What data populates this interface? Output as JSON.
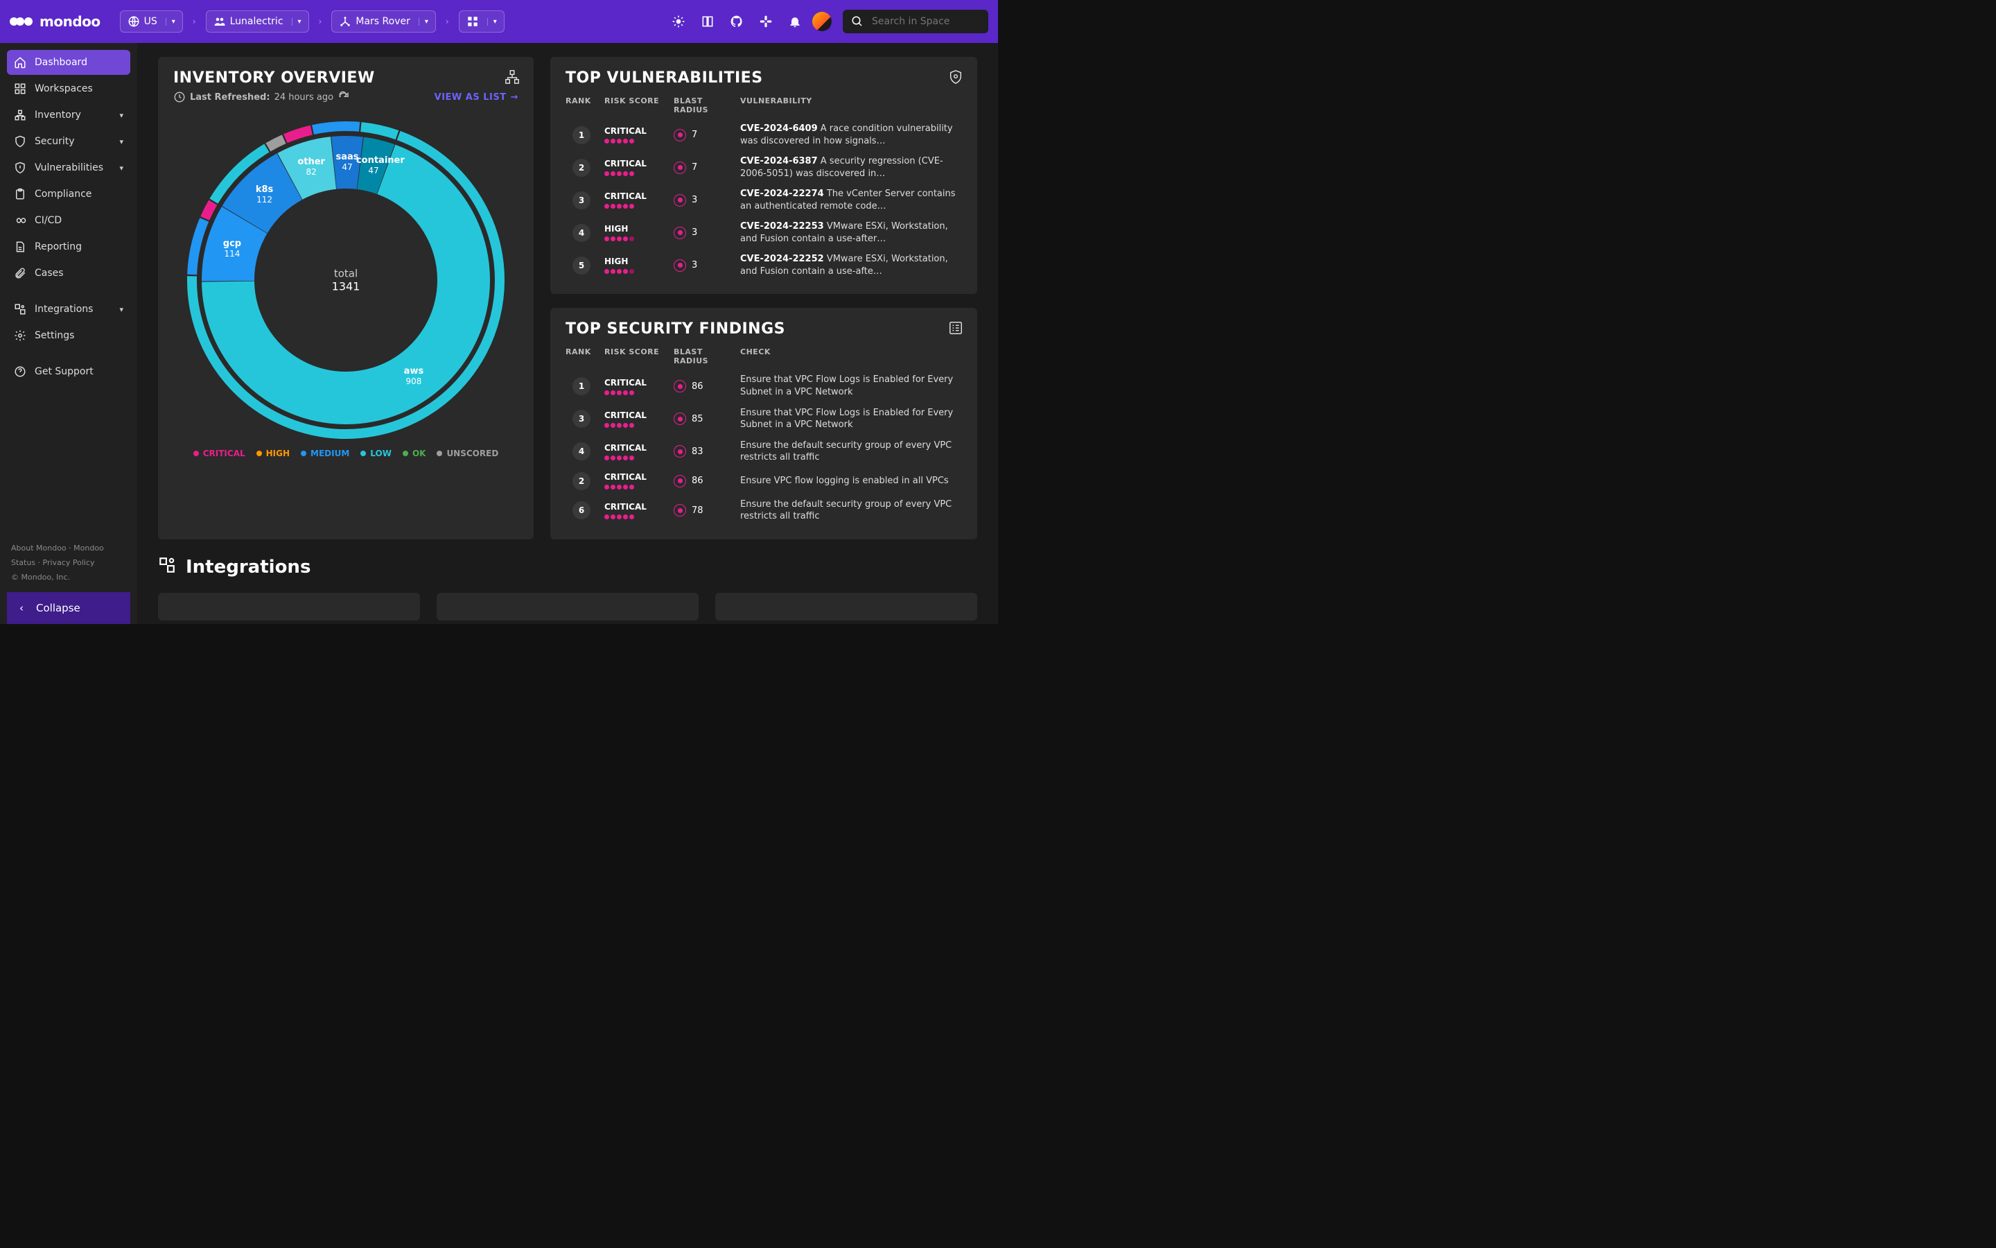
{
  "brand": "mondoo",
  "breadcrumbs": {
    "region": "US",
    "org": "Lunalectric",
    "space": "Mars Rover"
  },
  "search": {
    "placeholder": "Search in Space"
  },
  "sidebar": {
    "items": [
      {
        "label": "Dashboard",
        "active": true
      },
      {
        "label": "Workspaces"
      },
      {
        "label": "Inventory",
        "expand": true
      },
      {
        "label": "Security",
        "expand": true
      },
      {
        "label": "Vulnerabilities",
        "expand": true
      },
      {
        "label": "Compliance"
      },
      {
        "label": "CI/CD"
      },
      {
        "label": "Reporting"
      },
      {
        "label": "Cases"
      }
    ],
    "secondary": [
      {
        "label": "Integrations",
        "expand": true
      },
      {
        "label": "Settings"
      }
    ],
    "support": "Get Support",
    "footer_links": "About Mondoo · Mondoo Status · Privacy Policy",
    "copyright": "© Mondoo, Inc.",
    "collapse": "Collapse"
  },
  "inventory": {
    "title": "INVENTORY OVERVIEW",
    "last_refreshed_label": "Last Refreshed:",
    "last_refreshed_value": "24 hours ago",
    "view_as_list": "VIEW AS LIST",
    "center_label": "total",
    "center_value": "1341",
    "legend": [
      {
        "label": "CRITICAL",
        "color": "#e91e8c"
      },
      {
        "label": "HIGH",
        "color": "#ff9800"
      },
      {
        "label": "MEDIUM",
        "color": "#2196f3"
      },
      {
        "label": "LOW",
        "color": "#26c6da"
      },
      {
        "label": "OK",
        "color": "#4caf50"
      },
      {
        "label": "UNSCORED",
        "color": "#9e9e9e"
      }
    ]
  },
  "chart_data": {
    "type": "pie",
    "title": "Inventory Overview",
    "total": 1341,
    "categories": [
      "aws",
      "gcp",
      "k8s",
      "other",
      "saas",
      "container"
    ],
    "values": [
      908,
      114,
      112,
      82,
      47,
      47
    ],
    "outer_ring_legend": [
      "CRITICAL",
      "HIGH",
      "MEDIUM",
      "LOW",
      "OK",
      "UNSCORED"
    ]
  },
  "top_vuln": {
    "title": "TOP VULNERABILITIES",
    "headers": {
      "rank": "RANK",
      "risk": "RISK SCORE",
      "blast": "BLAST RADIUS",
      "desc": "VULNERABILITY"
    },
    "rows": [
      {
        "rank": "1",
        "risk": "CRITICAL",
        "dots": 5,
        "blast": "7",
        "id": "CVE-2024-6409",
        "desc": "A race condition vulnerability was discovered in how signals…"
      },
      {
        "rank": "2",
        "risk": "CRITICAL",
        "dots": 5,
        "blast": "7",
        "id": "CVE-2024-6387",
        "desc": "A security regression (CVE-2006-5051) was discovered in…"
      },
      {
        "rank": "3",
        "risk": "CRITICAL",
        "dots": 5,
        "blast": "3",
        "id": "CVE-2024-22274",
        "desc": "The vCenter Server contains an authenticated remote code…"
      },
      {
        "rank": "4",
        "risk": "HIGH",
        "dots": 4,
        "blast": "3",
        "id": "CVE-2024-22253",
        "desc": "VMware ESXi, Workstation, and Fusion contain a use-after…"
      },
      {
        "rank": "5",
        "risk": "HIGH",
        "dots": 4,
        "blast": "3",
        "id": "CVE-2024-22252",
        "desc": "VMware ESXi, Workstation, and Fusion contain a use-afte…"
      }
    ]
  },
  "top_find": {
    "title": "TOP SECURITY FINDINGS",
    "headers": {
      "rank": "RANK",
      "risk": "RISK SCORE",
      "blast": "BLAST RADIUS",
      "desc": "CHECK"
    },
    "rows": [
      {
        "rank": "1",
        "risk": "CRITICAL",
        "blast": "86",
        "desc": "Ensure that VPC Flow Logs is Enabled for Every Subnet in a VPC Network"
      },
      {
        "rank": "3",
        "risk": "CRITICAL",
        "blast": "85",
        "desc": "Ensure that VPC Flow Logs is Enabled for Every Subnet in a VPC Network"
      },
      {
        "rank": "4",
        "risk": "CRITICAL",
        "blast": "83",
        "desc": "Ensure the default security group of every VPC restricts all traffic"
      },
      {
        "rank": "2",
        "risk": "CRITICAL",
        "blast": "86",
        "desc": "Ensure VPC flow logging is enabled in all VPCs"
      },
      {
        "rank": "6",
        "risk": "CRITICAL",
        "blast": "78",
        "desc": "Ensure the default security group of every VPC restricts all traffic"
      }
    ]
  },
  "integrations_title": "Integrations"
}
